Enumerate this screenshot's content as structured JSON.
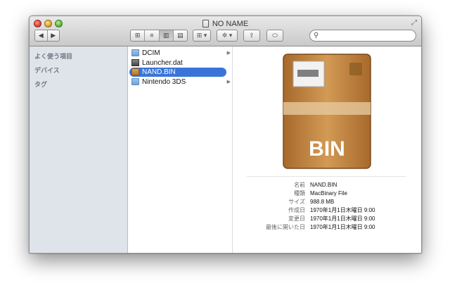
{
  "window": {
    "title": "NO NAME"
  },
  "toolbar": {
    "nav_back": "◀",
    "nav_forward": "▶",
    "view_icon": "⊞",
    "view_list": "≡",
    "view_columns": "▥",
    "view_coverflow": "▤",
    "arrange": "⊞ ▾",
    "action": "✲ ▾",
    "share": "⇪",
    "tags": "⬭",
    "search_placeholder": ""
  },
  "sidebar": {
    "sections": [
      "よく使う項目",
      "デバイス",
      "タグ"
    ]
  },
  "files": [
    {
      "name": "DCIM",
      "kind": "folder",
      "has_children": true
    },
    {
      "name": "Launcher.dat",
      "kind": "dat",
      "has_children": false
    },
    {
      "name": "NAND.BIN",
      "kind": "box",
      "has_children": false,
      "selected": true
    },
    {
      "name": "Nintendo 3DS",
      "kind": "folder",
      "has_children": true
    }
  ],
  "preview": {
    "box_label": "BIN",
    "info": [
      {
        "key": "名前",
        "value": "NAND.BIN"
      },
      {
        "key": "種類",
        "value": "MacBinary File"
      },
      {
        "key": "サイズ",
        "value": "988.8 MB"
      },
      {
        "key": "作成日",
        "value": "1970年1月1日木曜日 9:00"
      },
      {
        "key": "変更日",
        "value": "1970年1月1日木曜日 9:00"
      },
      {
        "key": "最後に開いた日",
        "value": "1970年1月1日木曜日 9:00"
      }
    ]
  },
  "colors": {
    "selection": "#3875d7",
    "sidebar": "#dee4ea",
    "box": "#c98c45"
  }
}
